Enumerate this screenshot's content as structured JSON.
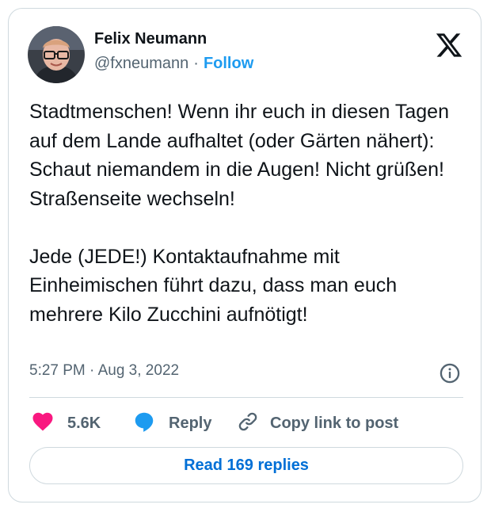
{
  "author": {
    "name": "Felix Neumann",
    "handle": "@fxneumann",
    "separator": "·",
    "follow_label": "Follow"
  },
  "tweet": {
    "paragraphs": [
      "Stadtmenschen! Wenn ihr euch in diesen Tagen auf dem Lande aufhaltet (oder Gärten nähert): Schaut niemandem in die Augen! Nicht grüßen! Straßenseite wechseln!",
      "Jede (JEDE!) Kontaktaufnahme mit Einheimischen führt dazu, dass man euch mehrere Kilo Zucchini aufnötigt!"
    ],
    "timestamp": "5:27 PM · Aug 3, 2022"
  },
  "actions": {
    "like_count": "5.6K",
    "reply_label": "Reply",
    "copy_label": "Copy link to post",
    "read_replies_label": "Read 169 replies"
  },
  "icons": {
    "brand": "x-logo-icon",
    "info": "info-icon",
    "like": "heart-icon",
    "reply": "speech-bubble-icon",
    "copy": "link-icon"
  },
  "colors": {
    "like": "#f91880",
    "reply": "#1d9bf0",
    "follow": "#1d9bf0",
    "read_replies": "#006fd6",
    "secondary_text": "#536471",
    "border": "#cfd9de"
  }
}
